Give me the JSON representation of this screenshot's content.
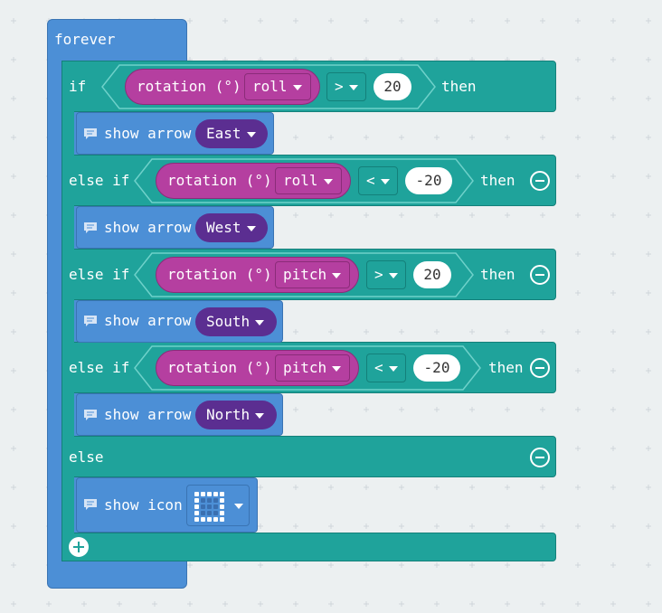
{
  "forever": {
    "label": "forever"
  },
  "if_block": {
    "if_label": "if",
    "then_label": "then",
    "else_if_label": "else if",
    "else_label": "else",
    "cond1": {
      "sensor": "rotation (°)",
      "axis": "roll",
      "operator": ">",
      "value": "20"
    },
    "cond2": {
      "sensor": "rotation (°)",
      "axis": "roll",
      "operator": "<",
      "value": "-20"
    },
    "cond3": {
      "sensor": "rotation (°)",
      "axis": "pitch",
      "operator": ">",
      "value": "20"
    },
    "cond4": {
      "sensor": "rotation (°)",
      "axis": "pitch",
      "operator": "<",
      "value": "-20"
    }
  },
  "actions": {
    "a1": {
      "label": "show arrow",
      "value": "East"
    },
    "a2": {
      "label": "show arrow",
      "value": "West"
    },
    "a3": {
      "label": "show arrow",
      "value": "South"
    },
    "a4": {
      "label": "show arrow",
      "value": "North"
    },
    "a5": {
      "label": "show icon"
    }
  },
  "colors": {
    "basic": "#4c8fd6",
    "logic": "#1fa39b",
    "input": "#b53fa0",
    "arrow_pill": "#5b2e91",
    "workspace": "#ecf0f1"
  },
  "icons": [
    "comment-icon",
    "dropdown-arrow-icon",
    "remove-branch-icon",
    "add-branch-icon",
    "led-grid-icon"
  ]
}
